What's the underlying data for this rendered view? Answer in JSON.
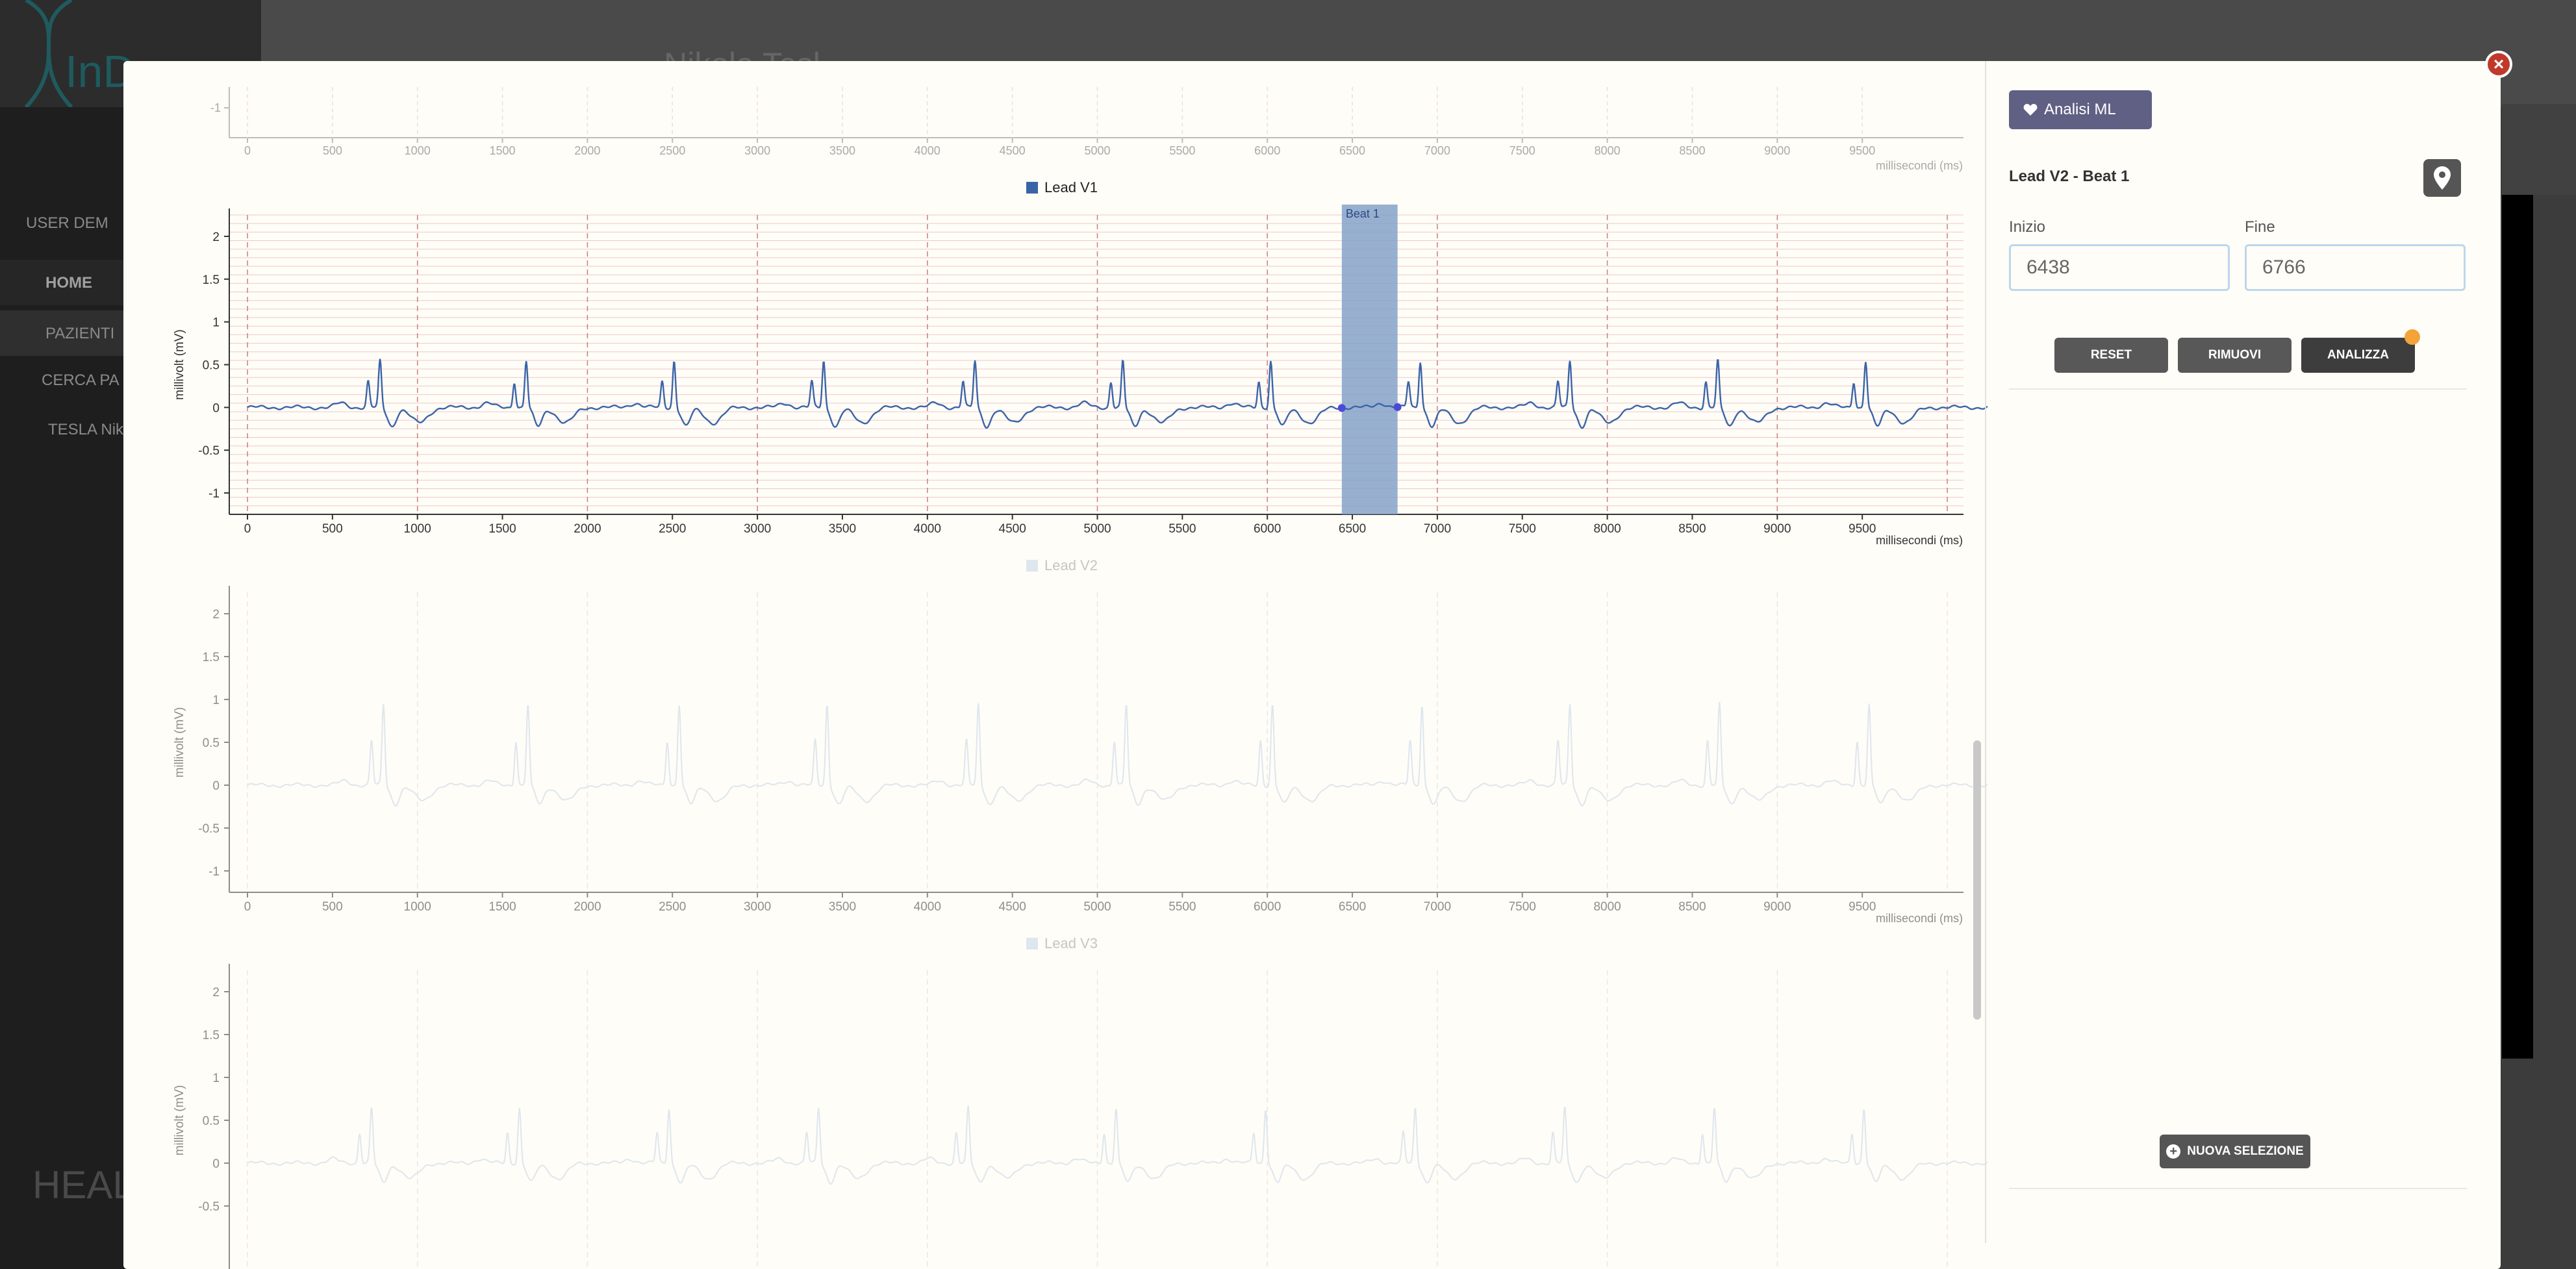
{
  "background": {
    "logo_text": "InD",
    "nav": {
      "user": "USER DEM",
      "home": "HOME",
      "pazienti": "PAZIENTI",
      "search": "CERCA PA",
      "patient": "TESLA Niko"
    },
    "header_name": "Nikola Tesl",
    "footer_brand": "HEAL"
  },
  "modal": {
    "close_label": "×",
    "right_panel": {
      "ml_button": "Analisi ML",
      "lead_title": "Lead V2 - Beat 1",
      "inizio_label": "Inizio",
      "inizio_value": "6438",
      "fine_label": "Fine",
      "fine_value": "6766",
      "reset": "RESET",
      "rimuovi": "RIMUOVI",
      "analizza": "ANALIZZA",
      "nuova_selezione": "NUOVA SELEZIONE"
    }
  },
  "chart_data": [
    {
      "type": "line",
      "title": "",
      "series_name": "",
      "partial": true,
      "xlabel": "millisecondi (ms)",
      "ylabel": "",
      "xlim": [
        0,
        10000
      ],
      "xticks": [
        0,
        500,
        1000,
        1500,
        2000,
        2500,
        3000,
        3500,
        4000,
        4500,
        5000,
        5500,
        6000,
        6500,
        7000,
        7500,
        8000,
        8500,
        9000,
        9500
      ],
      "yticks_visible": [
        -1
      ],
      "active": false
    },
    {
      "type": "line",
      "legend": "Lead V1",
      "xlabel": "millisecondi (ms)",
      "ylabel": "millivolt (mV)",
      "xlim": [
        0,
        10000
      ],
      "ylim": [
        -1.25,
        2.25
      ],
      "xticks": [
        0,
        500,
        1000,
        1500,
        2000,
        2500,
        3000,
        3500,
        4000,
        4500,
        5000,
        5500,
        6000,
        6500,
        7000,
        7500,
        8000,
        8500,
        9000,
        9500
      ],
      "yticks": [
        2,
        1.5,
        1,
        0.5,
        0,
        -0.5,
        -1
      ],
      "beats_ms": [
        780,
        1640,
        2510,
        3390,
        4280,
        5150,
        6020,
        6900,
        7780,
        8650,
        9520
      ],
      "r_amplitude": 0.55,
      "selection": {
        "label": "Beat 1",
        "start": 6438,
        "end": 6766
      },
      "active": true
    },
    {
      "type": "line",
      "legend": "Lead V2",
      "xlabel": "millisecondi (ms)",
      "ylabel": "millivolt (mV)",
      "xlim": [
        0,
        10000
      ],
      "ylim": [
        -1.25,
        2.25
      ],
      "xticks": [
        0,
        500,
        1000,
        1500,
        2000,
        2500,
        3000,
        3500,
        4000,
        4500,
        5000,
        5500,
        6000,
        6500,
        7000,
        7500,
        8000,
        8500,
        9000,
        9500
      ],
      "yticks": [
        2,
        1.5,
        1,
        0.5,
        0,
        -0.5,
        -1
      ],
      "beats_ms": [
        800,
        1650,
        2540,
        3410,
        4300,
        5170,
        6030,
        6910,
        7780,
        8660,
        9540
      ],
      "r_amplitude": 0.95,
      "active": false
    },
    {
      "type": "line",
      "legend": "Lead V3",
      "xlabel": "",
      "ylabel": "millivolt (mV)",
      "xlim": [
        0,
        10000
      ],
      "ylim": [
        -1.25,
        2.25
      ],
      "xticks": [],
      "yticks": [
        2,
        1.5,
        1,
        0.5,
        0,
        -0.5
      ],
      "beats_ms": [
        730,
        1600,
        2480,
        3360,
        4240,
        5110,
        5990,
        6870,
        7750,
        8630,
        9510
      ],
      "r_amplitude": 0.65,
      "active": false
    }
  ],
  "colors": {
    "active_line": "#3b64a8",
    "faded_line": "#c5d4e8",
    "selection": "#7e9cc6",
    "grid_red": "#f2c7c7",
    "orange": "#f2a33a"
  }
}
